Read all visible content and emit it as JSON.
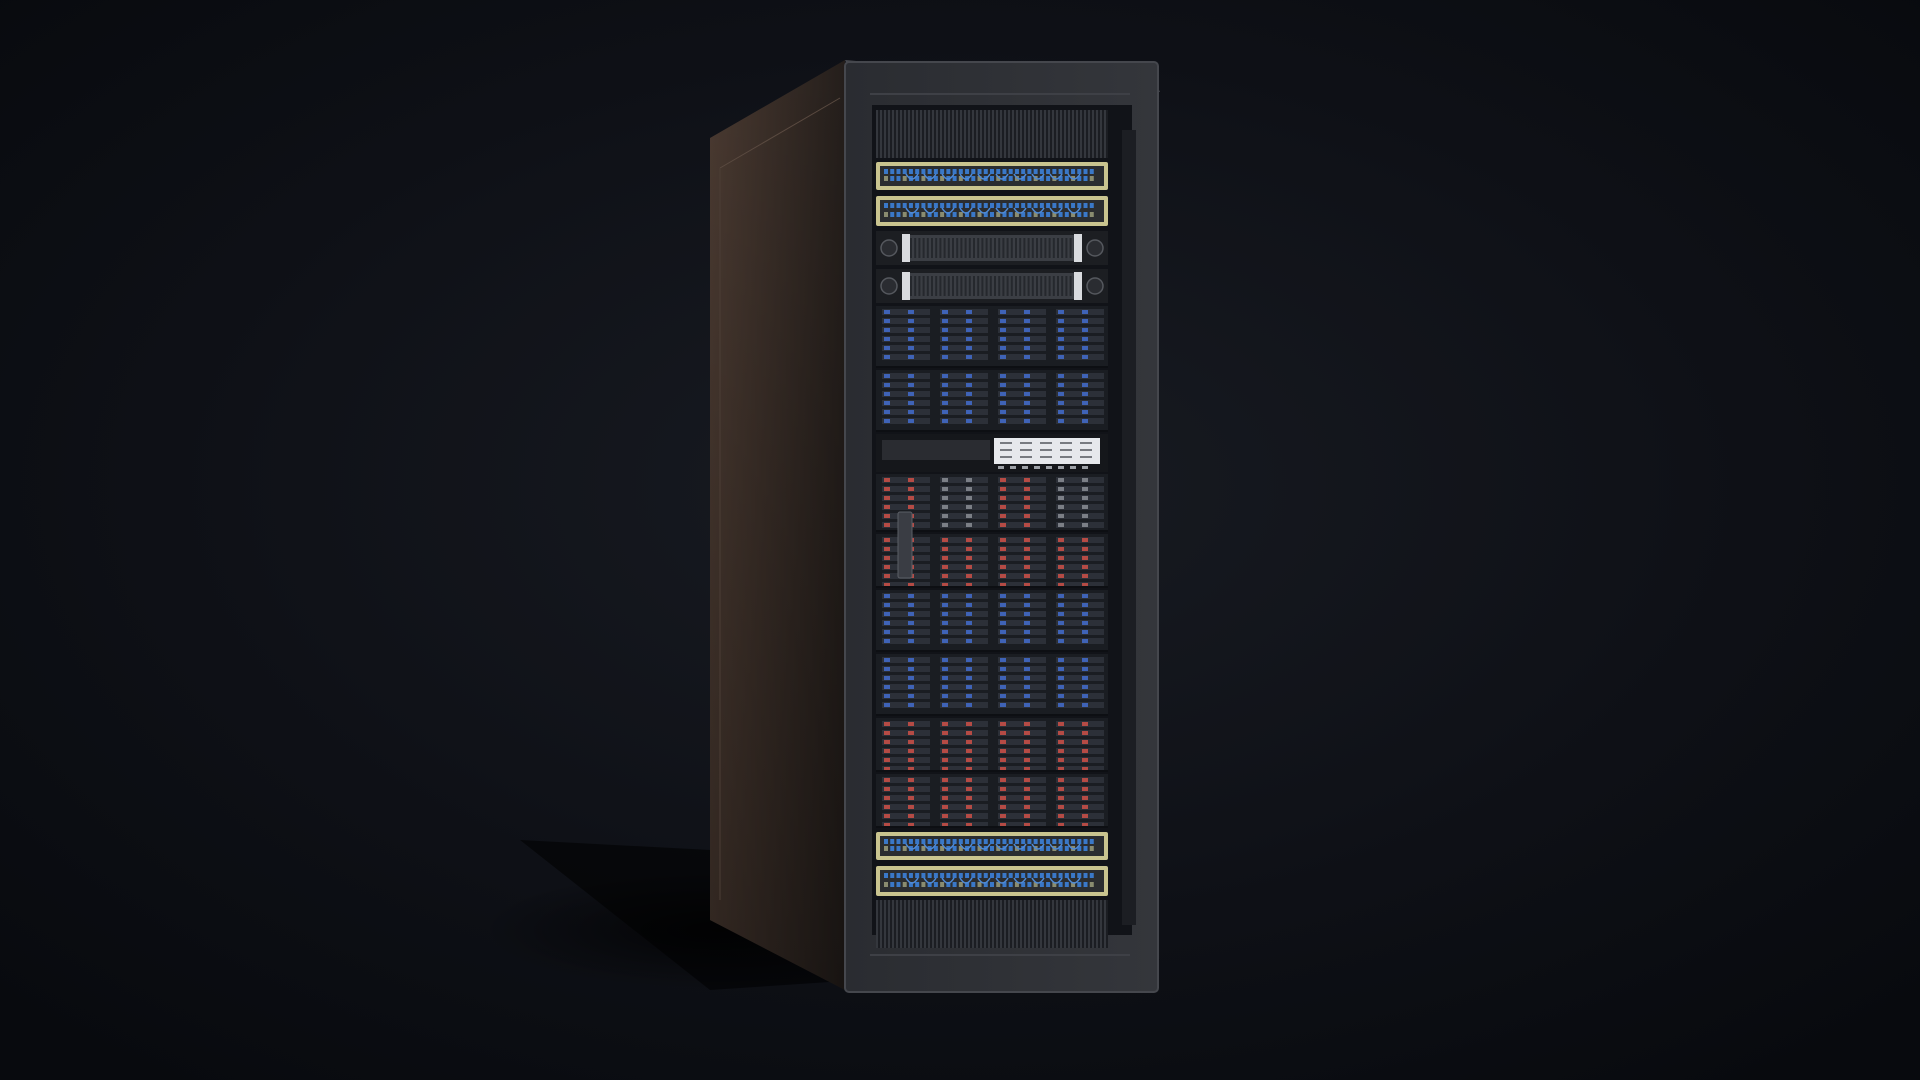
{
  "scene": {
    "subject": "server-rack",
    "colors": {
      "background": "#0b0d12",
      "cabinet_side": "#3a2f29",
      "cabinet_front": "#2c2e33",
      "bay": "#15181d",
      "switch_panel": "#c9c48f",
      "port_blue": "#3a78c8",
      "drive_blue": "#3f63b7",
      "drive_red": "#b54b45",
      "display_panel": "#e6e8ec"
    },
    "equipment": [
      "top-vent",
      "patch-panel",
      "network-switch",
      "server-2u",
      "server-2u",
      "storage-blue",
      "storage-blue",
      "kvm-console",
      "storage-mixed",
      "storage-red",
      "storage-blue",
      "storage-blue",
      "storage-red",
      "storage-red",
      "patch-panel",
      "network-switch",
      "bottom-vent"
    ]
  }
}
